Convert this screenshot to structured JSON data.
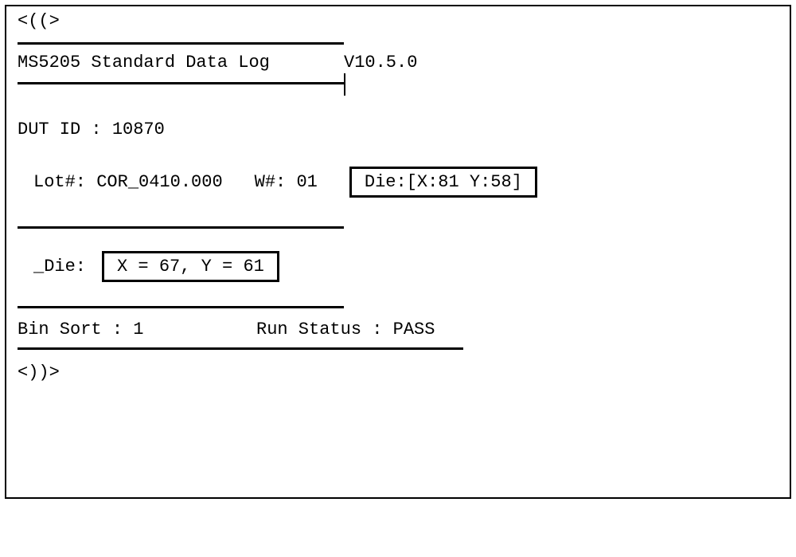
{
  "markers": {
    "open": "<((>",
    "close": "<))>"
  },
  "header": {
    "title": "MS5205 Standard Data Log",
    "version": "V10.5.0"
  },
  "dut": {
    "label": "DUT ID :",
    "id": "10870"
  },
  "lot": {
    "lot_label": "Lot#:",
    "lot_value": "COR_0410.000",
    "w_label": "W#:",
    "w_value": "01",
    "die_box": "Die:[X:81 Y:58]"
  },
  "die2": {
    "label": "_Die:",
    "value": "X = 67, Y = 61"
  },
  "status": {
    "bin_label": "Bin Sort :",
    "bin_value": "1",
    "run_label": "Run Status :",
    "run_value": "PASS"
  }
}
